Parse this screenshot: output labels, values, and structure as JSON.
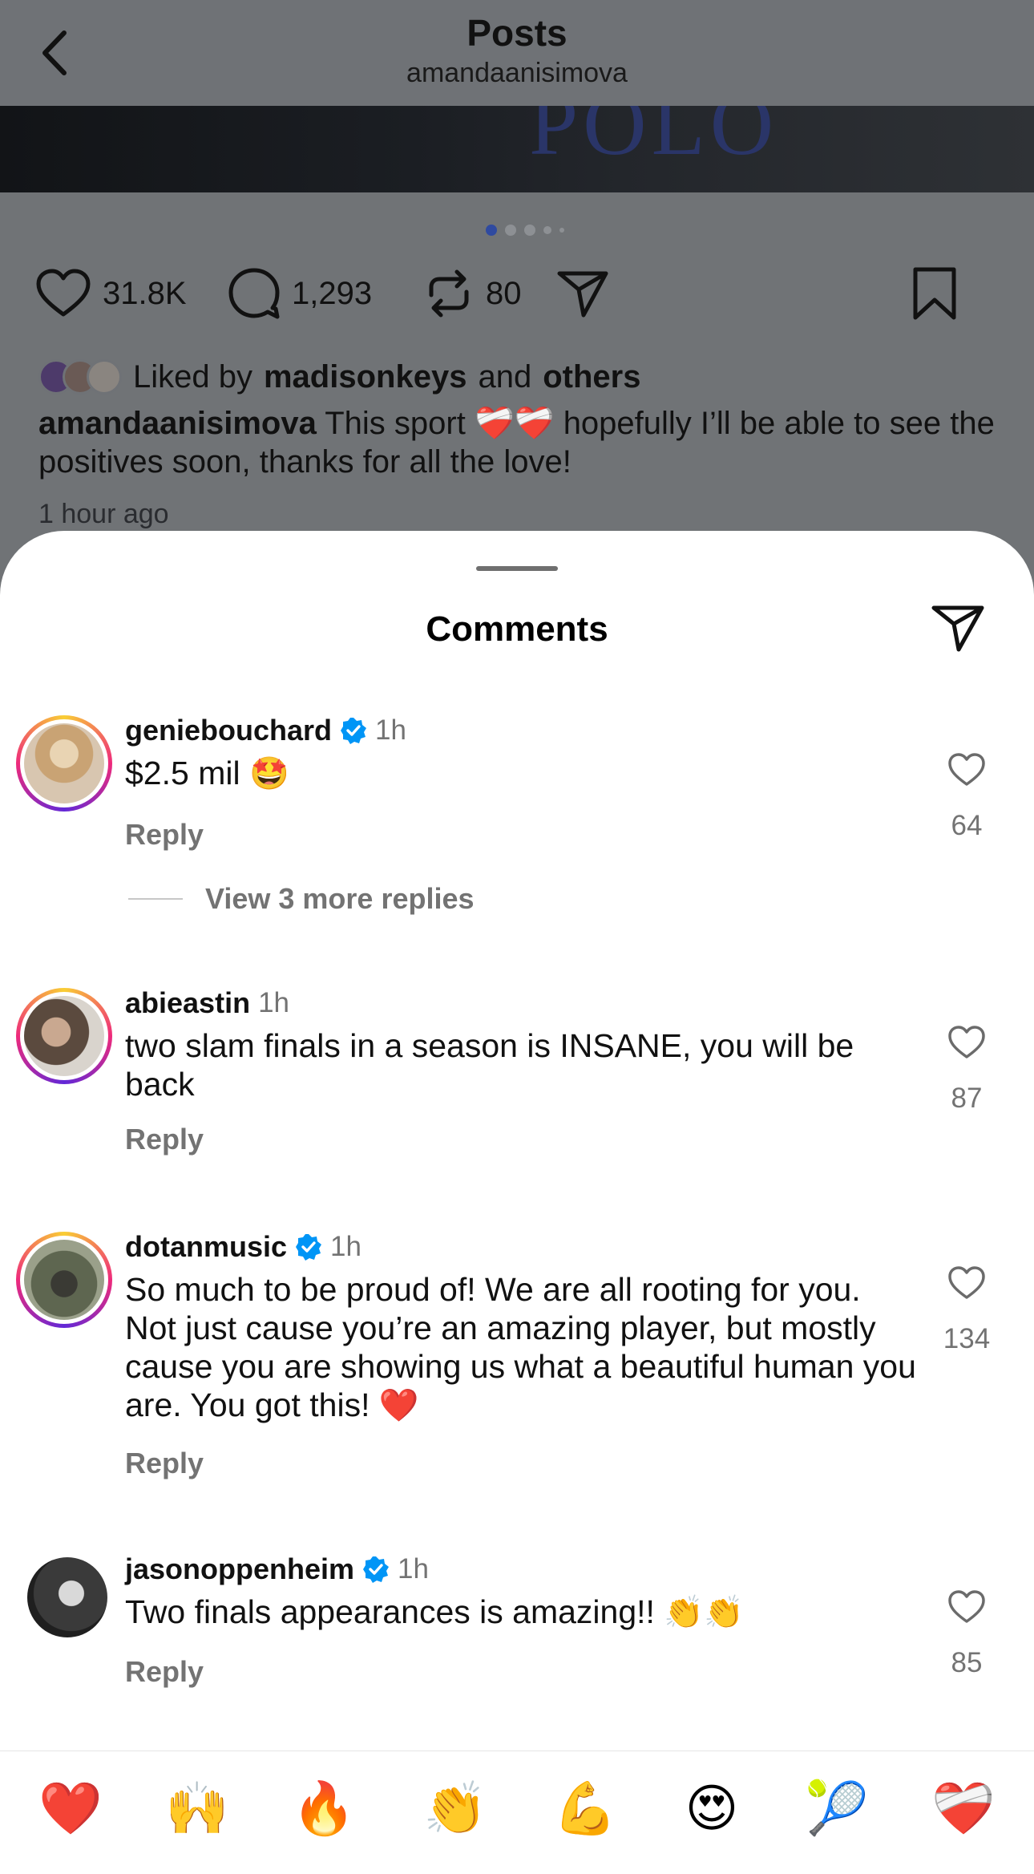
{
  "nav": {
    "title": "Posts",
    "username": "amandaanisimova",
    "back_icon": "chevron-left-icon"
  },
  "post": {
    "photo_text": "POLO",
    "carousel": {
      "count": 5,
      "active": 1
    },
    "actions": {
      "likes": "31.8K",
      "comments": "1,293",
      "reposts": "80"
    },
    "liked_by": {
      "prefix": "Liked by",
      "user": "madisonkeys",
      "conj": "and",
      "others": "others"
    },
    "caption": {
      "user": "amandaanisimova",
      "text_before": "This sport",
      "emoji": "❤️‍🩹❤️‍🩹",
      "text_after": "hopefully I’ll be able to see the positives soon, thanks for all the love!"
    },
    "time": "1 hour ago"
  },
  "sheet": {
    "title": "Comments"
  },
  "comments": [
    {
      "user": "geniebouchard",
      "verified": true,
      "time": "1h",
      "text": "$2.5 mil",
      "emoji": "🤩",
      "reply": "Reply",
      "likes": "64"
    },
    {
      "user": "abieastin",
      "verified": false,
      "time": "1h",
      "text": "two slam finals in a season is INSANE, you will be back",
      "emoji": "",
      "reply": "Reply",
      "likes": "87"
    },
    {
      "user": "dotanmusic",
      "verified": true,
      "time": "1h",
      "text": "So much to be proud of! We are all rooting for you. Not just cause you’re an amazing player, but mostly cause you are showing us what a beautiful human you are. You got this!",
      "emoji": "❤️",
      "reply": "Reply",
      "likes": "134"
    },
    {
      "user": "jasonoppenheim",
      "verified": true,
      "time": "1h",
      "text": "Two finals appearances is amazing!!",
      "emoji": "👏👏",
      "reply": "Reply",
      "likes": "85"
    }
  ],
  "view_replies": "View 3 more replies",
  "reactions": [
    "❤️",
    "🙌",
    "🔥",
    "👏",
    "💪",
    "😍",
    "🎾",
    "❤️‍🩹"
  ],
  "colors": {
    "verified": "#0095f6",
    "secondary_text": "#737373",
    "overlay": "#6f7276"
  }
}
